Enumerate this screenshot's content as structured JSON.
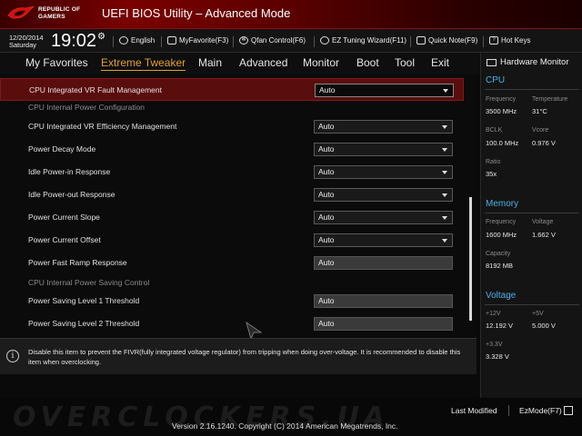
{
  "header": {
    "logo_line1": "REPUBLIC OF",
    "logo_line2": "GAMERS",
    "title": "UEFI BIOS Utility – Advanced Mode"
  },
  "infobar": {
    "date": "12/20/2014",
    "day": "Saturday",
    "time": "19:02",
    "language": "English",
    "myfavorite": "MyFavorite(F3)",
    "qfan": "Qfan Control(F6)",
    "ez_tuning": "EZ Tuning Wizard(F11)",
    "quick_note": "Quick Note(F9)",
    "hot_keys": "Hot Keys"
  },
  "nav": {
    "tabs": [
      {
        "label": "My Favorites",
        "active": false
      },
      {
        "label": "Extreme Tweaker",
        "active": true
      },
      {
        "label": "Main",
        "active": false
      },
      {
        "label": "Advanced",
        "active": false
      },
      {
        "label": "Monitor",
        "active": false
      },
      {
        "label": "Boot",
        "active": false
      },
      {
        "label": "Tool",
        "active": false
      },
      {
        "label": "Exit",
        "active": false
      }
    ]
  },
  "settings": [
    {
      "label": "CPU Integrated VR Fault Management",
      "value": "Auto",
      "type": "dropdown",
      "selected": true
    },
    {
      "label": "CPU Internal Power Configuration",
      "type": "section"
    },
    {
      "label": "CPU Integrated VR Efficiency Management",
      "value": "Auto",
      "type": "dropdown"
    },
    {
      "label": "Power Decay Mode",
      "value": "Auto",
      "type": "dropdown"
    },
    {
      "label": "Idle Power-in Response",
      "value": "Auto",
      "type": "dropdown"
    },
    {
      "label": "Idle Power-out Response",
      "value": "Auto",
      "type": "dropdown"
    },
    {
      "label": "Power Current Slope",
      "value": "Auto",
      "type": "dropdown"
    },
    {
      "label": "Power Current Offset",
      "value": "Auto",
      "type": "dropdown"
    },
    {
      "label": "Power Fast Ramp Response",
      "value": "Auto",
      "type": "text"
    },
    {
      "label": "CPU Internal Power Saving Control",
      "type": "section"
    },
    {
      "label": "Power Saving Level 1 Threshold",
      "value": "Auto",
      "type": "text"
    },
    {
      "label": "Power Saving Level 2 Threshold",
      "value": "Auto",
      "type": "text"
    }
  ],
  "hardware_monitor": {
    "title": "Hardware Monitor",
    "cpu": {
      "heading": "CPU",
      "frequency_label": "Frequency",
      "frequency": "3500 MHz",
      "temperature_label": "Temperature",
      "temperature": "31°C",
      "bclk_label": "BCLK",
      "bclk": "100.0 MHz",
      "vcore_label": "Vcore",
      "vcore": "0.976 V",
      "ratio_label": "Ratio",
      "ratio": "35x"
    },
    "memory": {
      "heading": "Memory",
      "frequency_label": "Frequency",
      "frequency": "1600 MHz",
      "voltage_label": "Voltage",
      "voltage": "1.662 V",
      "capacity_label": "Capacity",
      "capacity": "8192 MB"
    },
    "voltage": {
      "heading": "Voltage",
      "v12_label": "+12V",
      "v12": "12.192 V",
      "v5_label": "+5V",
      "v5": "5.000 V",
      "v33_label": "+3.3V",
      "v33": "3.328 V"
    }
  },
  "help": {
    "text": "Disable this item to prevent the FIVR(fully integrated voltage regulator) from tripping when doing over-voltage. It is recommended to disable this item when overclocking."
  },
  "bottom": {
    "watermark": "OVERCLOCKERS.UA",
    "last_modified": "Last Modified",
    "ezmode": "EzMode(F7)",
    "version": "Version 2.16.1240. Copyright (C) 2014 American Megatrends, Inc."
  },
  "colors": {
    "accent_tab": "#e0a030",
    "hw_heading": "#4ab0e8",
    "selected_row": "#5a0d0d",
    "header_red": "#7a0000"
  }
}
